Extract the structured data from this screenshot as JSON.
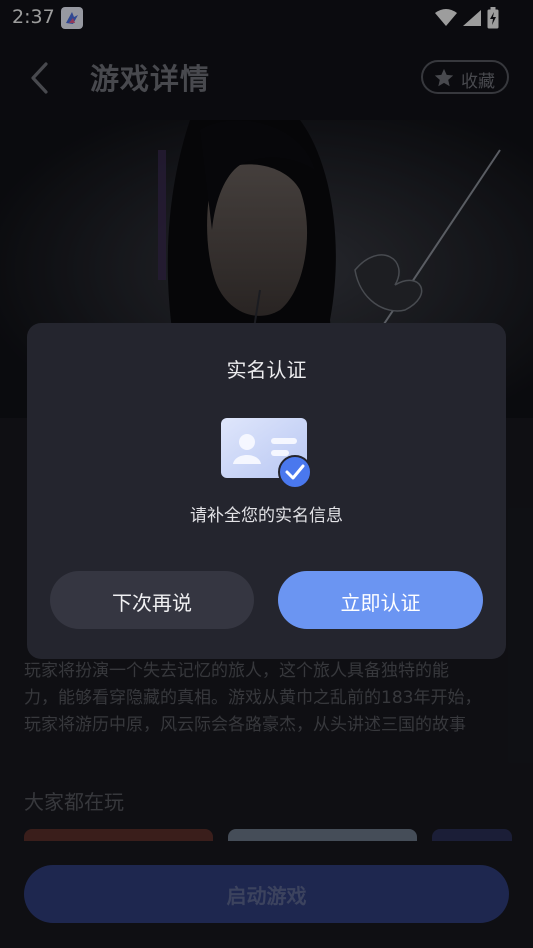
{
  "status_bar": {
    "time": "2:37"
  },
  "header": {
    "title": "游戏详情",
    "favorite_label": "收藏"
  },
  "description": {
    "lines": [
      "玩家将扮演一个失去记忆的旅人，这个旅人具备独特的能",
      "力，能够看穿隐藏的真相。游戏从黄巾之乱前的183年开始，",
      "玩家将游历中原，风云际会各路豪杰，从头讲述三国的故事"
    ]
  },
  "section": {
    "everyone_playing": "大家都在玩"
  },
  "start_button": {
    "label": "启动游戏"
  },
  "dialog": {
    "title": "实名认证",
    "message": "请补全您的实名信息",
    "later_label": "下次再说",
    "verify_label": "立即认证"
  },
  "colors": {
    "accent": "#6b95f2",
    "dialog_bg": "#24252e",
    "secondary_button": "#353641",
    "start_button": "#2f3c7a"
  },
  "icons": {
    "back": "chevron-left-icon",
    "favorite": "star-icon",
    "wifi": "wifi-icon",
    "signal": "signal-icon",
    "battery": "battery-charging-icon",
    "id_card": "id-card-verified-icon"
  }
}
